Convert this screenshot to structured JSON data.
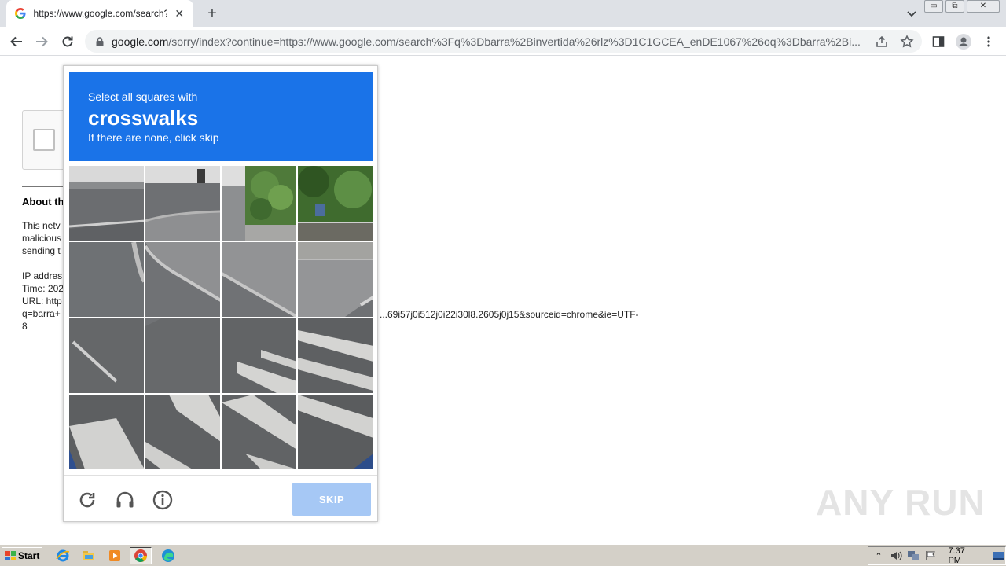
{
  "browser": {
    "tab": {
      "title": "https://www.google.com/search?q=barra+invertida"
    },
    "url_host": "google.com",
    "url_path": "/sorry/index?continue=https://www.google.com/search%3Fq%3Dbarra%2Binvertida%26rlz%3D1C1GCEA_enDE1067%26oq%3Dbarra%2Bi...",
    "window_buttons": {
      "minimize": "▭",
      "restore": "⧉",
      "close": "✕"
    }
  },
  "page": {
    "about_heading": "About th",
    "para_lines": [
      "This netv",
      "malicious",
      "sending t"
    ],
    "ip_lines": [
      "IP addres",
      "Time: 202",
      "URL: http",
      "q=barra+",
      "8"
    ],
    "url_tail": "...69i57j0i512j0i22i30l8.2605j0j15&sourceid=chrome&ie=UTF-"
  },
  "captcha": {
    "instruction_line1": "Select all squares with",
    "target_object": "crosswalks",
    "instruction_line3": "If there are none, click skip",
    "skip_label": "SKIP",
    "header_color": "#1a73e8",
    "skip_color": "#a6c8f5"
  },
  "watermark": "ANY RUN",
  "taskbar": {
    "start_label": "Start",
    "clock": "7:37 PM",
    "apps": [
      "ie-icon",
      "explorer-icon",
      "media-player-icon",
      "chrome-icon",
      "edge-icon"
    ]
  }
}
